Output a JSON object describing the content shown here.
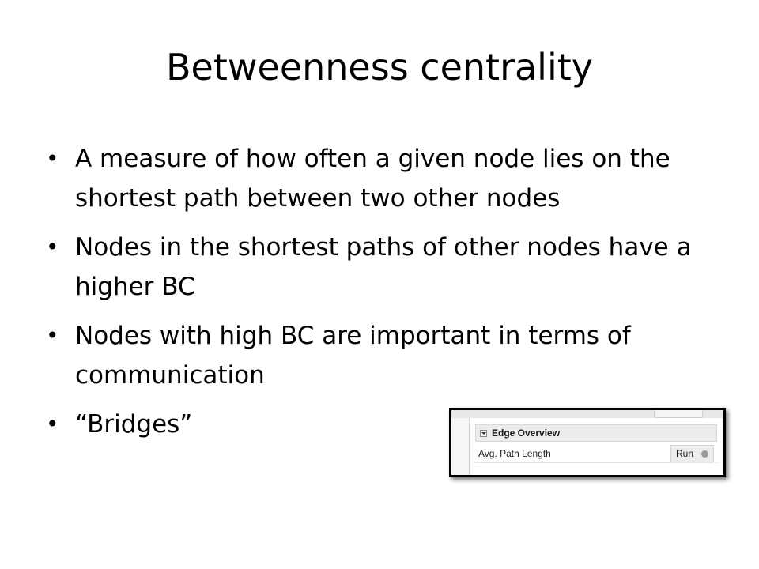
{
  "slide": {
    "title": "Betweenness centrality",
    "bullets": [
      {
        "marker": "•",
        "text": "A measure of how often a given node lies on the shortest path between two other nodes"
      },
      {
        "marker": "•",
        "text": "Nodes in the shortest paths of other nodes have a higher BC"
      },
      {
        "marker": "•",
        "text": "Nodes with high BC are important in terms of communication"
      },
      {
        "marker": "•",
        "text": "“Bridges”"
      }
    ]
  },
  "panel": {
    "section_title": "Edge Overview",
    "metric_label": "Avg. Path Length",
    "run_label": "Run",
    "icons": {
      "collapse": "collapse-toggle-icon",
      "status": "status-dot-icon"
    }
  }
}
